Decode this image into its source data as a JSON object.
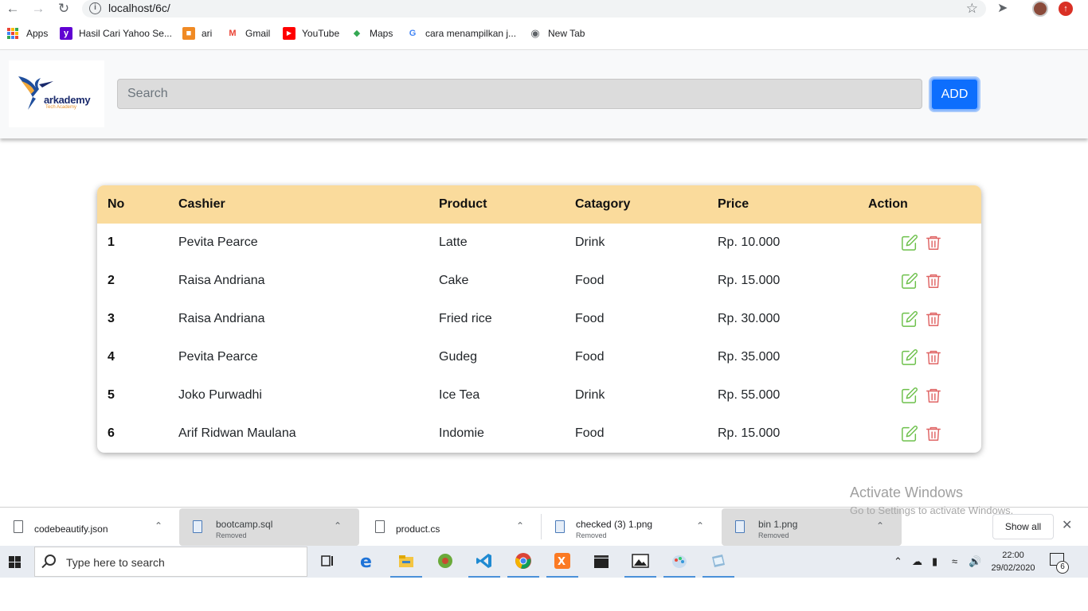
{
  "browser": {
    "url": "localhost/6c/",
    "bookmarks": [
      {
        "label": "Apps"
      },
      {
        "label": "Hasil Cari Yahoo Se..."
      },
      {
        "label": "ari"
      },
      {
        "label": "Gmail"
      },
      {
        "label": "YouTube"
      },
      {
        "label": "Maps"
      },
      {
        "label": "cara menampilkan j..."
      },
      {
        "label": "New Tab"
      }
    ]
  },
  "header": {
    "logo_text": "arkademy",
    "logo_sub": "Tech Academy",
    "search_placeholder": "Search",
    "add_label": "ADD"
  },
  "table": {
    "columns": [
      "No",
      "Cashier",
      "Product",
      "Catagory",
      "Price",
      "Action"
    ],
    "rows": [
      {
        "no": "1",
        "cashier": "Pevita Pearce",
        "product": "Latte",
        "category": "Drink",
        "price": "Rp. 10.000"
      },
      {
        "no": "2",
        "cashier": "Raisa Andriana",
        "product": "Cake",
        "category": "Food",
        "price": "Rp. 15.000"
      },
      {
        "no": "3",
        "cashier": "Raisa Andriana",
        "product": "Fried rice",
        "category": "Food",
        "price": "Rp. 30.000"
      },
      {
        "no": "4",
        "cashier": "Pevita Pearce",
        "product": "Gudeg",
        "category": "Food",
        "price": "Rp. 35.000"
      },
      {
        "no": "5",
        "cashier": "Joko Purwadhi",
        "product": "Ice Tea",
        "category": "Drink",
        "price": "Rp. 55.000"
      },
      {
        "no": "6",
        "cashier": "Arif Ridwan Maulana",
        "product": "Indomie",
        "category": "Food",
        "price": "Rp. 15.000"
      }
    ]
  },
  "colors": {
    "header_bg": "#fadb9c",
    "edit": "#6cc04a",
    "delete": "#e06666",
    "add_button": "#0d6efd"
  },
  "downloads": {
    "items": [
      {
        "name": "codebeautify.json",
        "status": ""
      },
      {
        "name": "bootcamp.sql",
        "status": "Removed"
      },
      {
        "name": "product.cs",
        "status": ""
      },
      {
        "name": "checked (3) 1.png",
        "status": "Removed"
      },
      {
        "name": "bin 1.png",
        "status": "Removed"
      }
    ],
    "show_all": "Show all"
  },
  "watermark": {
    "line1": "Activate Windows",
    "line2": "Go to Settings to activate Windows."
  },
  "taskbar": {
    "search_text": "Type here to search",
    "time": "22:00",
    "date": "29/02/2020",
    "notification_count": "6"
  }
}
